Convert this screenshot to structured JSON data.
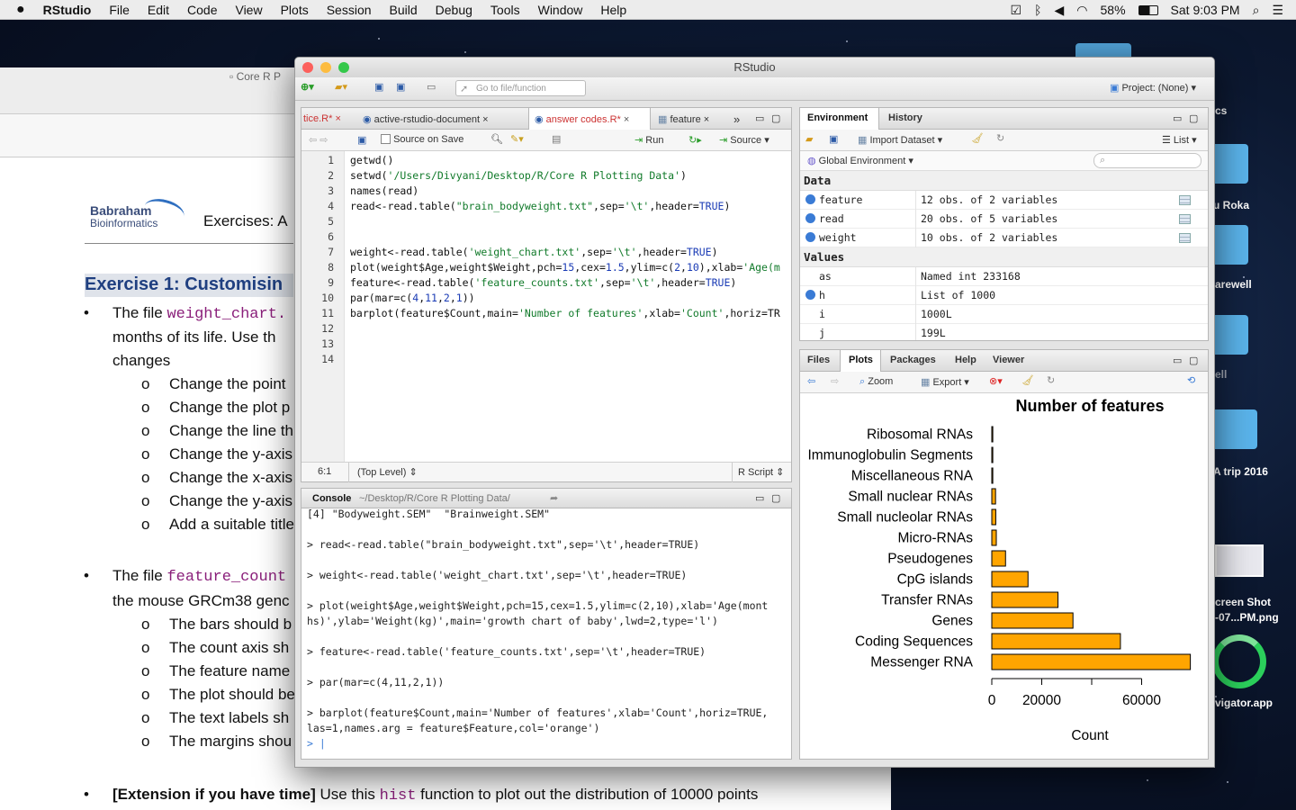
{
  "menubar": {
    "app": "RStudio",
    "items": [
      "File",
      "Edit",
      "Code",
      "View",
      "Plots",
      "Session",
      "Build",
      "Debug",
      "Tools",
      "Window",
      "Help"
    ],
    "battery": "58%",
    "clock": "Sat 9:03 PM"
  },
  "desktop": {
    "items": [
      "cs",
      "u Roka",
      "arewell",
      "ell",
      "A trip 2016",
      "creen Shot",
      "-07...PM.png",
      "vigator.app"
    ]
  },
  "doc": {
    "tab_label": "Core R P",
    "logo_line1": "Babraham",
    "logo_line2": "Bioinformatics",
    "header": "Exercises: A",
    "exercise_title": "Exercise 1: Customisin",
    "p1_a": "The file ",
    "p1_code": "weight_chart.",
    "p1_line2": "months of its life.  Use th",
    "p1_line3": "changes",
    "sub1": [
      "Change the point",
      "Change the plot p",
      "Change the line th",
      "Change the y-axis",
      "Change the x-axis",
      "Change the y-axis",
      "Add a suitable title"
    ],
    "p2_a": "The file ",
    "p2_code": "feature_count",
    "p2_line2": "the mouse GRCm38 genc",
    "sub2": [
      "The bars should b",
      "The count axis sh",
      "The feature name",
      "The plot should be",
      "The text labels sh",
      "The margins shou"
    ],
    "ext_bold": "[Extension if you have time]",
    "ext_text": " Use this ",
    "ext_code": "hist",
    "ext_rest": " function to plot out the distribution of 10000 points"
  },
  "rstudio": {
    "title": "RStudio",
    "goto_placeholder": "Go to file/function",
    "project": "Project: (None)",
    "source": {
      "tabs": [
        "tice.R*",
        "active-rstudio-document",
        "answer codes.R*",
        "feature"
      ],
      "source_on_save": "Source on Save",
      "run": "Run",
      "source_btn": "Source",
      "lines": [
        "getwd()",
        "setwd('/Users/Divyani/Desktop/R/Core R Plotting Data')",
        "names(read)",
        "read<-read.table(\"brain_bodyweight.txt\",sep='\\t',header=TRUE)",
        "",
        "",
        "weight<-read.table('weight_chart.txt',sep='\\t',header=TRUE)",
        "plot(weight$Age,weight$Weight,pch=15,cex=1.5,ylim=c(2,10),xlab='Age(m",
        "feature<-read.table('feature_counts.txt',sep='\\t',header=TRUE)",
        "par(mar=c(4,11,2,1))",
        "barplot(feature$Count,main='Number of features',xlab='Count',horiz=TR",
        "",
        "",
        ""
      ],
      "status_pos": "6:1",
      "status_scope": "(Top Level)",
      "status_type": "R Script"
    },
    "console": {
      "tab": "Console",
      "path": "~/Desktop/R/Core R Plotting Data/",
      "lines": [
        "[4] \"Bodyweight.SEM\"  \"Brainweight.SEM\"",
        "",
        "> read<-read.table(\"brain_bodyweight.txt\",sep='\\t',header=TRUE)",
        "",
        "> weight<-read.table('weight_chart.txt',sep='\\t',header=TRUE)",
        "",
        "> plot(weight$Age,weight$Weight,pch=15,cex=1.5,ylim=c(2,10),xlab='Age(mont",
        "hs)',ylab='Weight(kg)',main='growth chart of baby',lwd=2,type='l')",
        "",
        "> feature<-read.table('feature_counts.txt',sep='\\t',header=TRUE)",
        "",
        "> par(mar=c(4,11,2,1))",
        "",
        "> barplot(feature$Count,main='Number of features',xlab='Count',horiz=TRUE,",
        "las=1,names.arg = feature$Feature,col='orange')"
      ],
      "prompt": ">"
    },
    "env": {
      "tabs": [
        "Environment",
        "History"
      ],
      "import": "Import Dataset",
      "list": "List",
      "scope": "Global Environment",
      "data_hdr": "Data",
      "values_hdr": "Values",
      "data": [
        {
          "name": "feature",
          "val": "12 obs. of 2 variables"
        },
        {
          "name": "read",
          "val": "20 obs. of 5 variables"
        },
        {
          "name": "weight",
          "val": "10 obs. of 2 variables"
        }
      ],
      "values": [
        {
          "name": "as",
          "val": "Named int 233168"
        },
        {
          "name": "h",
          "val": "List of 1000"
        },
        {
          "name": "i",
          "val": "1000L"
        },
        {
          "name": "j",
          "val": "199L"
        }
      ]
    },
    "plots": {
      "tabs": [
        "Files",
        "Plots",
        "Packages",
        "Help",
        "Viewer"
      ],
      "zoom": "Zoom",
      "export": "Export"
    }
  },
  "chart_data": {
    "type": "bar",
    "orientation": "horizontal",
    "title": "Number of features",
    "xlabel": "Count",
    "ylabel": "",
    "categories": [
      "Ribosomal RNAs",
      "Immunoglobulin Segments",
      "Miscellaneous RNA",
      "Small nuclear RNAs",
      "Small nucleolar RNAs",
      "Micro-RNAs",
      "Pseudogenes",
      "CpG islands",
      "Transfer RNAs",
      "Genes",
      "Coding Sequences",
      "Messenger RNA"
    ],
    "values": [
      400,
      400,
      400,
      1500,
      1600,
      1800,
      5500,
      14500,
      26500,
      32500,
      51500,
      79500
    ],
    "xlim": [
      0,
      80000
    ],
    "xticks": [
      0,
      20000,
      40000,
      60000
    ],
    "xtick_labels": [
      "0",
      "20000",
      "",
      "60000"
    ],
    "color": "#ffa500",
    "grid": false
  }
}
